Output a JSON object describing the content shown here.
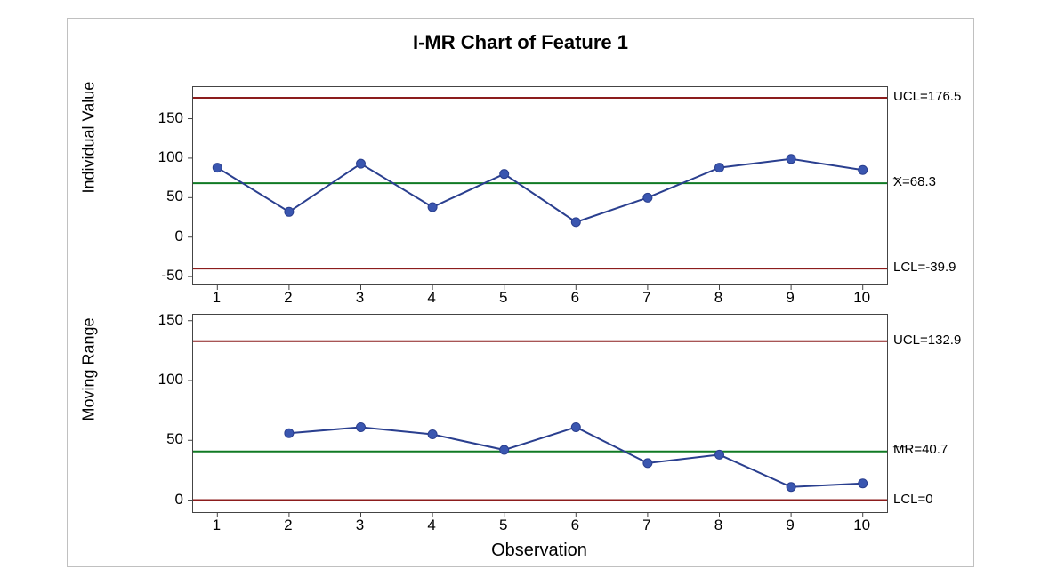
{
  "title": "I-MR Chart of Feature 1",
  "xlabel": "Observation",
  "panels": {
    "top": {
      "ylabel": "Individual Value",
      "ymin": -60,
      "ymax": 190,
      "yticks": [
        -50,
        0,
        50,
        100,
        150
      ],
      "ucl": {
        "value": 176.5,
        "label": "UCL=176.5"
      },
      "center": {
        "value": 68.3,
        "label": "X=68.3",
        "bar": "_"
      },
      "lcl": {
        "value": -39.9,
        "label": "LCL=-39.9"
      }
    },
    "bot": {
      "ylabel": "Moving Range",
      "ymin": -10,
      "ymax": 155,
      "yticks": [
        0,
        50,
        100,
        150
      ],
      "ucl": {
        "value": 132.9,
        "label": "UCL=132.9"
      },
      "center": {
        "value": 40.7,
        "label": "MR=40.7",
        "bar": "__"
      },
      "lcl": {
        "value": 0,
        "label": "LCL=0"
      }
    }
  },
  "x": [
    1,
    2,
    3,
    4,
    5,
    6,
    7,
    8,
    9,
    10
  ],
  "chart_data": [
    {
      "type": "line",
      "panel": "top",
      "title": "Individual Value",
      "xlabel": "Observation",
      "ylabel": "Individual Value",
      "x": [
        1,
        2,
        3,
        4,
        5,
        6,
        7,
        8,
        9,
        10
      ],
      "values": [
        88,
        32,
        93,
        38,
        80,
        19,
        50,
        88,
        99,
        85
      ],
      "center_line": 68.3,
      "ucl": 176.5,
      "lcl": -39.9,
      "ylim": [
        -60,
        190
      ]
    },
    {
      "type": "line",
      "panel": "bot",
      "title": "Moving Range",
      "xlabel": "Observation",
      "ylabel": "Moving Range",
      "x": [
        2,
        3,
        4,
        5,
        6,
        7,
        8,
        9,
        10
      ],
      "values": [
        56,
        61,
        55,
        42,
        61,
        31,
        38,
        11,
        14
      ],
      "center_line": 40.7,
      "ucl": 132.9,
      "lcl": 0,
      "ylim": [
        -10,
        155
      ]
    }
  ],
  "colors": {
    "limit": "#8c1d1d",
    "center": "#107a24",
    "series": "#2a3f8f",
    "marker_fill": "#3a56b0"
  }
}
